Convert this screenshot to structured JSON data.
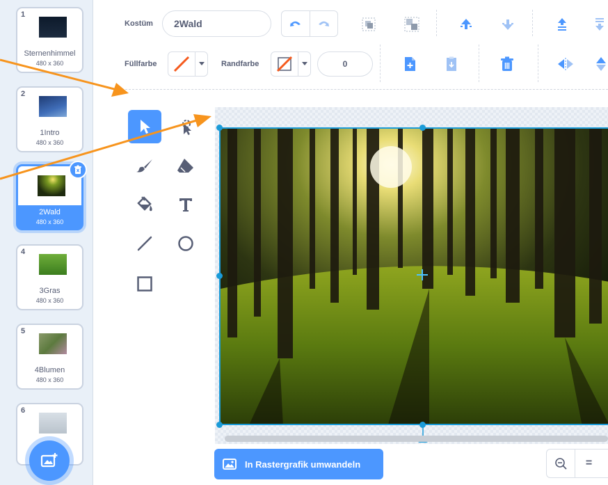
{
  "costumes": [
    {
      "number": "1",
      "name": "Sternenhimmel",
      "size": "480 x 360"
    },
    {
      "number": "2",
      "name": "1Intro",
      "size": "480 x 360"
    },
    {
      "number": "3",
      "name": "2Wald",
      "size": "480 x 360"
    },
    {
      "number": "4",
      "name": "3Gras",
      "size": "480 x 360"
    },
    {
      "number": "5",
      "name": "4Blumen",
      "size": "480 x 360"
    },
    {
      "number": "6",
      "name": "",
      "size": ""
    }
  ],
  "selected_costume": "3",
  "toolbar": {
    "costume_label": "Kostüm",
    "costume_name": "2Wald",
    "fill_label": "Füllfarbe",
    "outline_label": "Randfarbe",
    "outline_width": "0"
  },
  "convert_button": {
    "label": "In Rastergrafik umwandeln"
  },
  "zoom": {
    "reset": "="
  },
  "colors": {
    "accent": "#4c97ff",
    "selection": "#1a9bd8",
    "annotation_arrow": "#f7941d",
    "text": "#575e75"
  }
}
